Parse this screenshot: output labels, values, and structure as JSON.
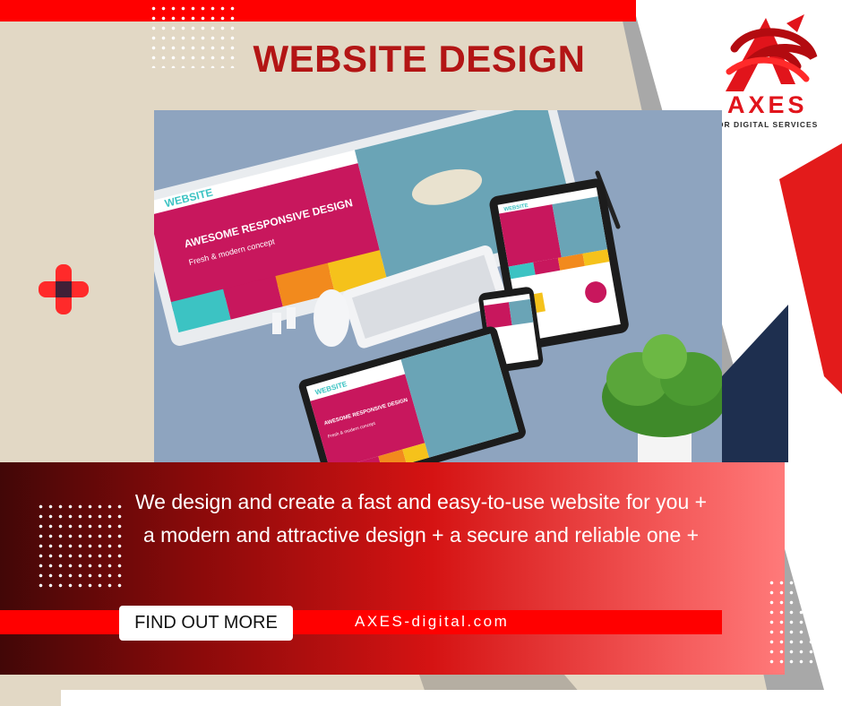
{
  "title": "WEBSITE DESIGN",
  "brand": {
    "name": "AXES",
    "tagline": "FOR DIGITAL SERVICES"
  },
  "hero_screens": {
    "desktop": {
      "small_title": "WEBSITE",
      "headline": "AWESOME RESPONSIVE DESIGN",
      "subline": "Fresh & modern concept"
    },
    "laptop": {
      "small_title": "WEBSITE",
      "headline": "AWESOME RESPONSIVE DESIGN",
      "subline": "Fresh & modern concept"
    },
    "tablet": {
      "small_title": "WEBSITE",
      "headline": "AWESOME RESPONSIVE DESIGN"
    }
  },
  "description": "We design and create a fast and easy-to-use website for you + a modern and attractive design + a secure and reliable one +",
  "cta": {
    "label": "FIND OUT MORE",
    "url": "AXES-digital.com"
  },
  "colors": {
    "red": "#ff0000",
    "dark_red": "#b31515",
    "navy": "#1e2f4f",
    "beige": "#e2d8c5",
    "gray": "#aaaaaa"
  },
  "icons": [
    "plus-icon",
    "axes-logo-icon"
  ]
}
